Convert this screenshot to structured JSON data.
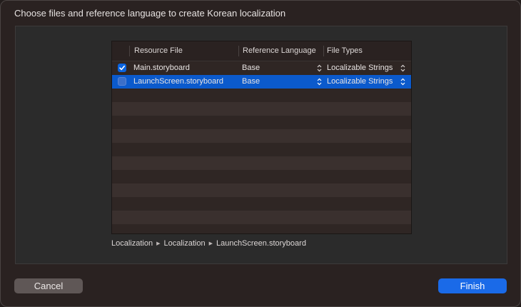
{
  "dialog": {
    "title": "Choose files and reference language to create Korean localization"
  },
  "table": {
    "headers": {
      "resource_file": "Resource File",
      "reference_language": "Reference Language",
      "file_types": "File Types"
    },
    "rows": [
      {
        "checked": true,
        "file": "Main.storyboard",
        "language": "Base",
        "type": "Localizable Strings",
        "selected": false
      },
      {
        "checked": false,
        "file": "LaunchScreen.storyboard",
        "language": "Base",
        "type": "Localizable Strings",
        "selected": true
      }
    ]
  },
  "path": {
    "parts": [
      "Localization",
      "Localization",
      "LaunchScreen.storyboard"
    ],
    "separator_icon": "triangle-right-icon"
  },
  "buttons": {
    "cancel": "Cancel",
    "finish": "Finish"
  },
  "colors": {
    "selection": "#0b5acc",
    "accent": "#1a6ae8"
  }
}
